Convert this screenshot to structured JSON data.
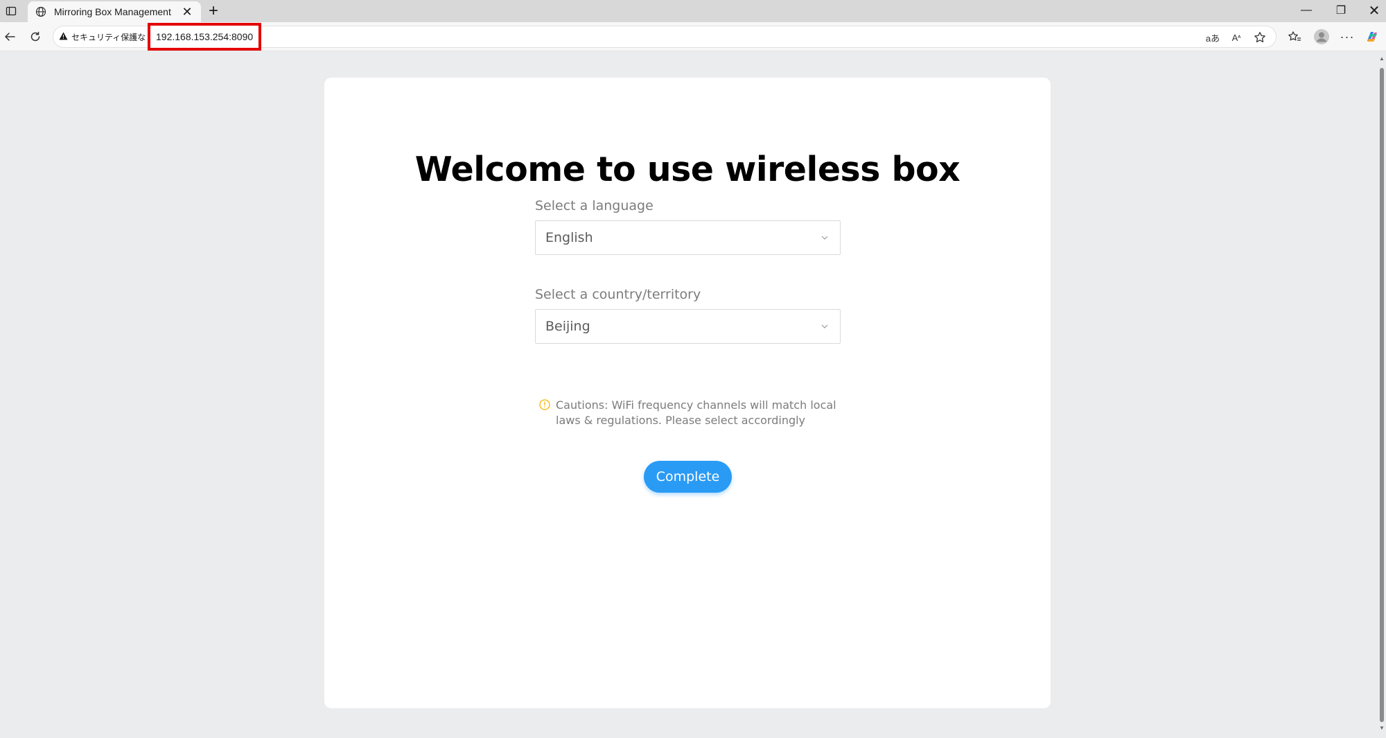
{
  "browser": {
    "tab": {
      "title": "Mirroring Box Management",
      "close": "✕"
    },
    "new_tab": "+",
    "window": {
      "minimize": "—",
      "restore": "❐",
      "close": "✕"
    },
    "address": {
      "security_label": "セキュリティ保護なし",
      "url": "192.168.153.254:8090",
      "highlight_color": "#e30000"
    }
  },
  "page": {
    "heading": "Welcome to use wireless box",
    "language": {
      "label": "Select a language",
      "value": "English"
    },
    "country": {
      "label": "Select a country/territory",
      "value": "Beijing"
    },
    "caution": "Cautions: WiFi frequency channels will match local laws & regulations. Please select accordingly",
    "complete_button": "Complete",
    "accent_color": "#2a9bf5",
    "warning_color": "#f5b400"
  }
}
